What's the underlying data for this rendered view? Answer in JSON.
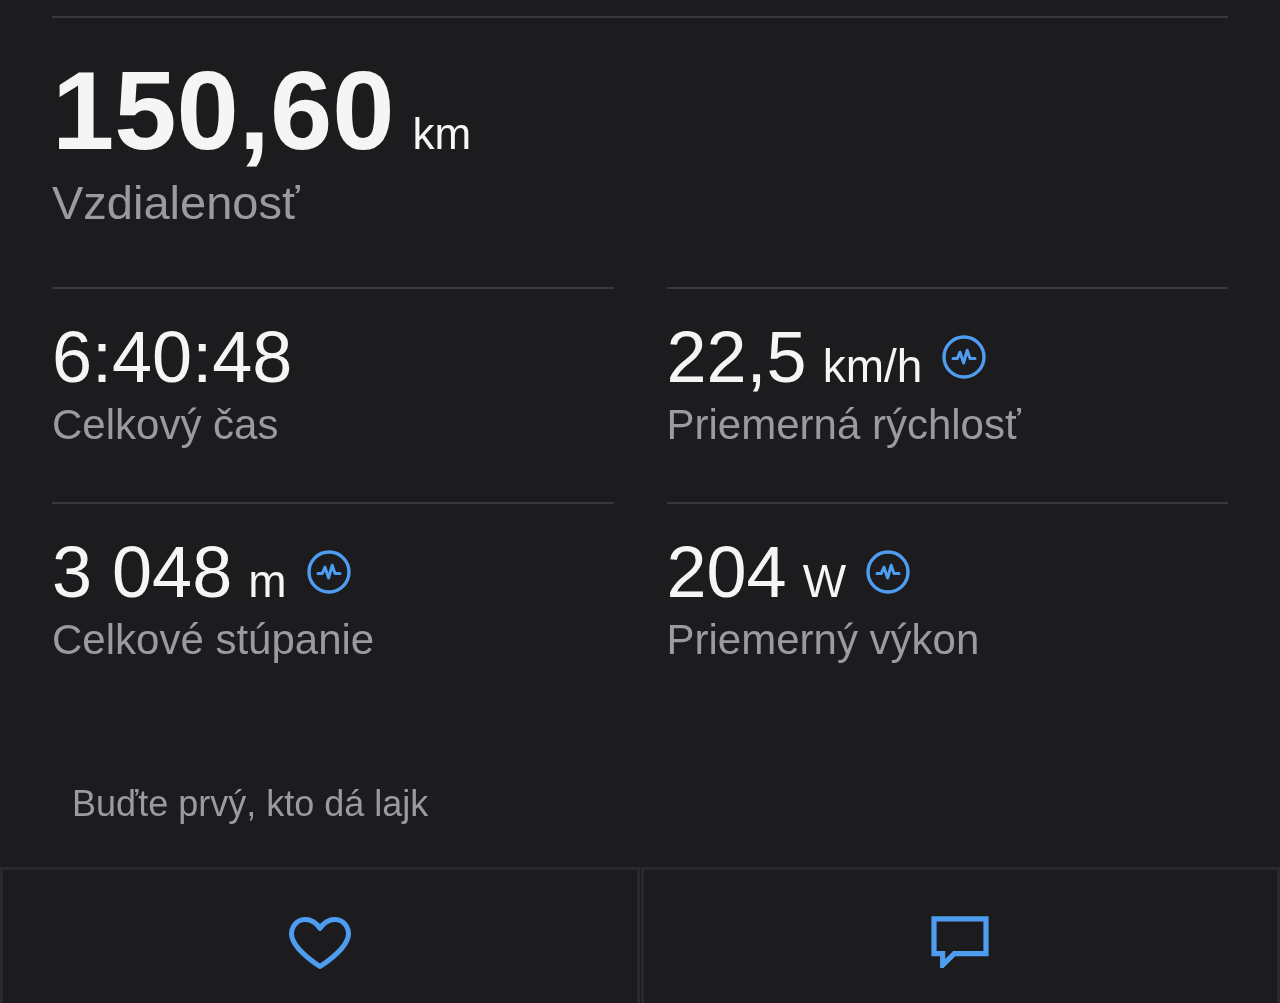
{
  "summary": {
    "value": "150,60",
    "unit": "km",
    "label": "Vzdialenosť"
  },
  "stats": [
    {
      "value": "6:40:48",
      "label": "Celkový čas",
      "pulse_icon": false
    },
    {
      "value": "22,5",
      "unit": "km/h",
      "label": "Priemerná rýchlosť",
      "pulse_icon": true
    },
    {
      "value": "3 048",
      "unit": "m",
      "label": "Celkové stúpanie",
      "pulse_icon": true
    },
    {
      "value": "204",
      "unit": "W",
      "label": "Priemerný výkon",
      "pulse_icon": true
    }
  ],
  "likes_text": "Buďte prvý, kto dá lajk",
  "actions": [
    {
      "kind": "like"
    },
    {
      "kind": "comment"
    }
  ]
}
